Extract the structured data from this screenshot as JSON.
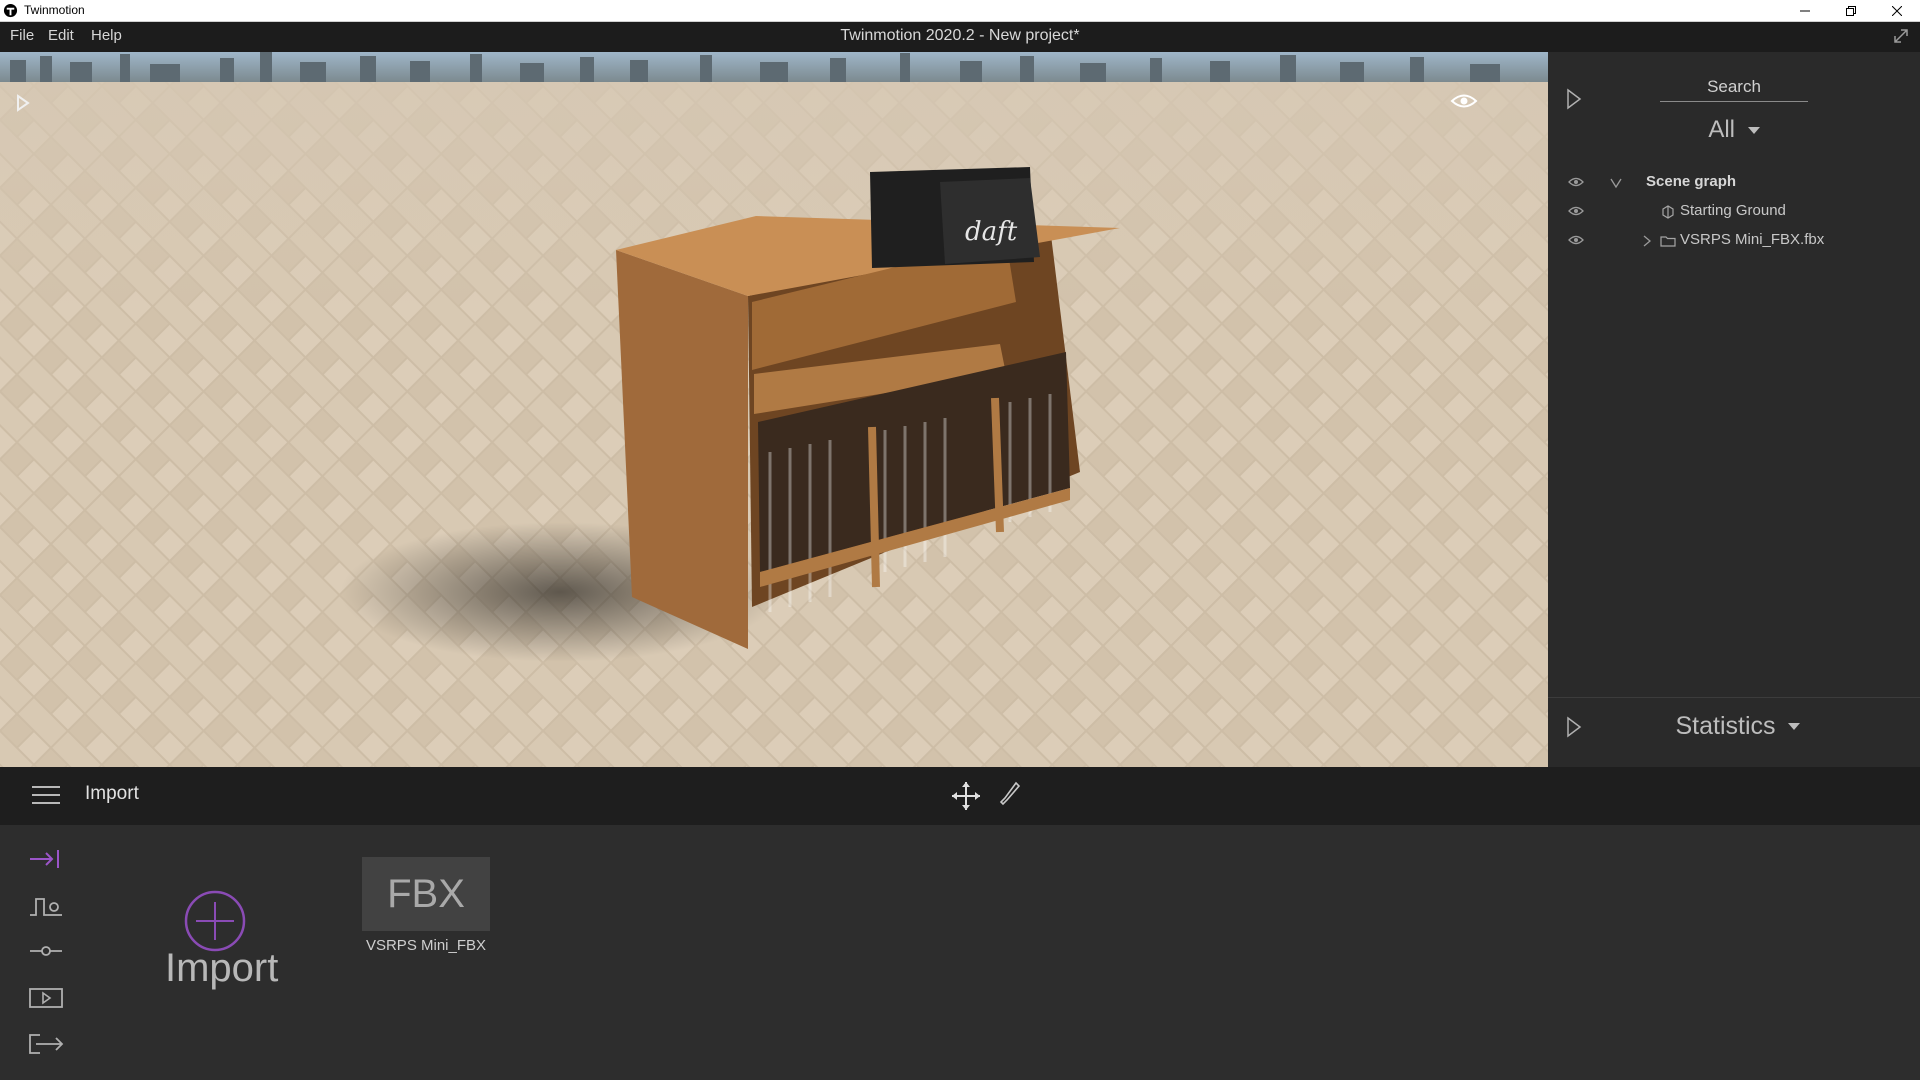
{
  "window": {
    "app_name": "Twinmotion",
    "document_title": "Twinmotion 2020.2 - New project*"
  },
  "menu": {
    "items": [
      "File",
      "Edit",
      "Help"
    ]
  },
  "right_panel": {
    "search_label": "Search",
    "filter_value": "All",
    "scene_graph": {
      "root": "Scene graph",
      "children": [
        "Starting Ground",
        "VSRPS Mini_FBX.fbx"
      ]
    },
    "statistics_label": "Statistics"
  },
  "bottom_bar": {
    "section_title": "Import"
  },
  "library": {
    "import_label": "Import",
    "items": [
      {
        "tile_text": "FBX",
        "label": "VSRPS Mini_FBX"
      }
    ]
  },
  "colors": {
    "accent": "#9b55c9",
    "panel_bg": "#2a2a2a",
    "toolbar_bg": "#1e1e1e"
  }
}
